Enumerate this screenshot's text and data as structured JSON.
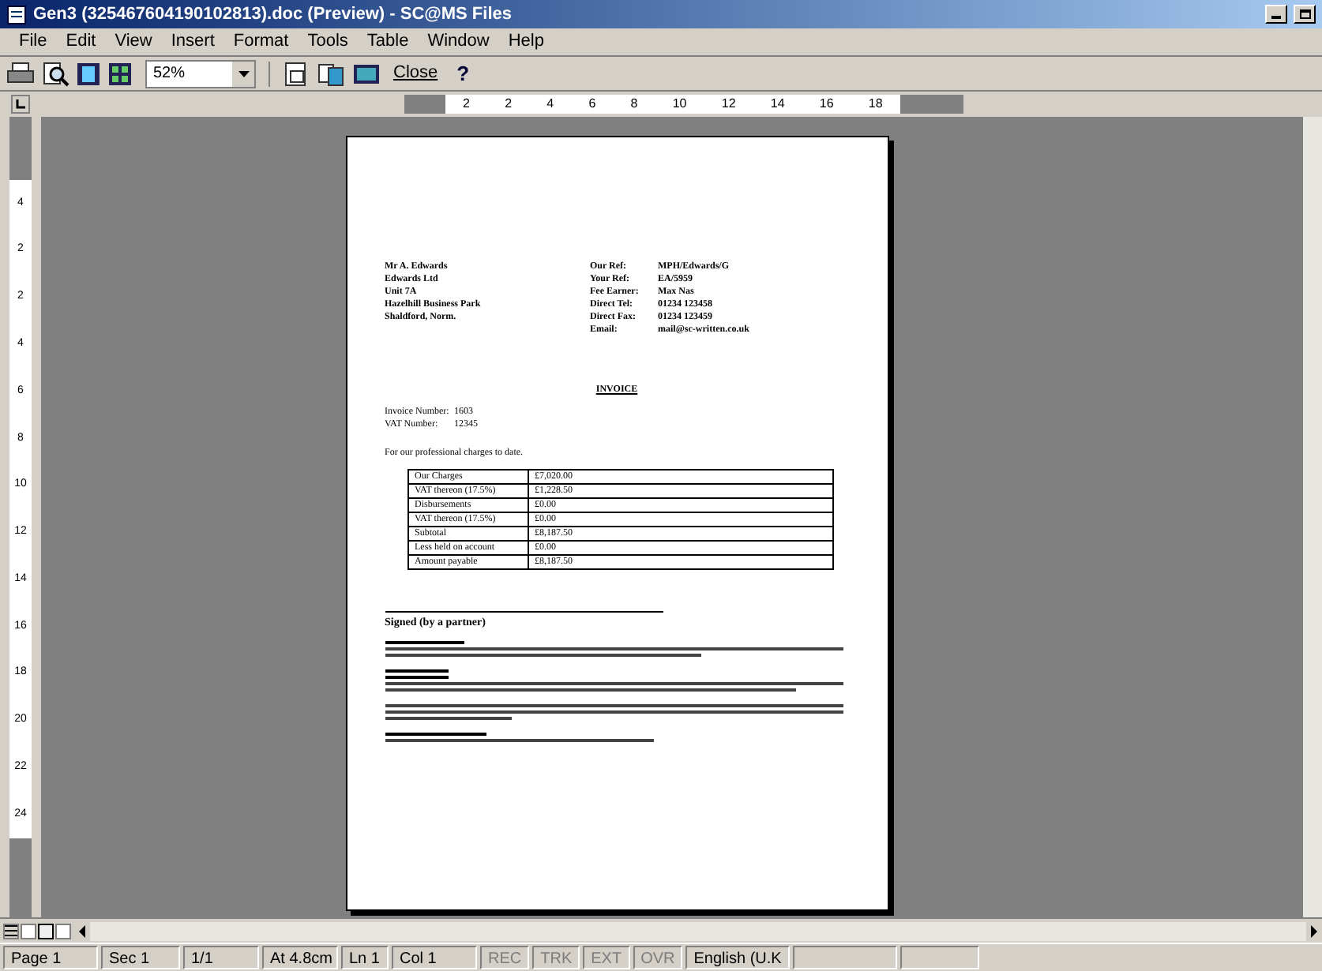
{
  "window": {
    "title": "Gen3 (325467604190102813).doc (Preview) - SC@MS Files"
  },
  "menu": [
    "File",
    "Edit",
    "View",
    "Insert",
    "Format",
    "Tools",
    "Table",
    "Window",
    "Help"
  ],
  "toolbar": {
    "zoom": "52%",
    "close": "Close",
    "help": "?"
  },
  "ruler": {
    "horizontal": [
      "2",
      "2",
      "4",
      "6",
      "8",
      "10",
      "12",
      "14",
      "16",
      "18"
    ],
    "vertical": [
      "4",
      "2",
      "2",
      "4",
      "6",
      "8",
      "10",
      "12",
      "14",
      "16",
      "18",
      "20",
      "22",
      "24"
    ]
  },
  "document": {
    "address": [
      "Mr A. Edwards",
      "Edwards Ltd",
      "Unit 7A",
      "Hazelhill Business Park",
      "Shaldford, Norm."
    ],
    "refs": [
      {
        "label": "Our Ref:",
        "value": "MPH/Edwards/G"
      },
      {
        "label": "Your Ref:",
        "value": "EA/5959"
      },
      {
        "label": "Fee Earner:",
        "value": "Max Nas"
      },
      {
        "label": "Direct Tel:",
        "value": "01234 123458"
      },
      {
        "label": "Direct Fax:",
        "value": "01234 123459"
      },
      {
        "label": "Email:",
        "value": "mail@sc-written.co.uk"
      }
    ],
    "heading": "INVOICE",
    "numbers": [
      {
        "label": "Invoice Number:",
        "value": "1603"
      },
      {
        "label": "VAT Number:",
        "value": "12345"
      }
    ],
    "intro": "For our professional charges to date.",
    "charges": [
      {
        "item": "Our Charges",
        "amount": "£7,020.00"
      },
      {
        "item": "VAT thereon (17.5%)",
        "amount": "£1,228.50"
      },
      {
        "item": "Disbursements",
        "amount": "£0.00"
      },
      {
        "item": "VAT thereon (17.5%)",
        "amount": "£0.00"
      },
      {
        "item": "Subtotal",
        "amount": "£8,187.50"
      },
      {
        "item": "Less held on account",
        "amount": "£0.00"
      },
      {
        "item": "Amount payable",
        "amount": "£8,187.50"
      }
    ],
    "signature": "Signed (by a partner)"
  },
  "status_bar": [
    {
      "text": "Page 1",
      "disabled": false
    },
    {
      "text": "Sec 1",
      "disabled": false
    },
    {
      "text": "1/1",
      "disabled": false
    },
    {
      "text": "At 4.8cm",
      "disabled": false
    },
    {
      "text": "Ln 1",
      "disabled": false
    },
    {
      "text": "Col 1",
      "disabled": false
    },
    {
      "text": "REC",
      "disabled": true
    },
    {
      "text": "TRK",
      "disabled": true
    },
    {
      "text": "EXT",
      "disabled": true
    },
    {
      "text": "OVR",
      "disabled": true
    },
    {
      "text": "English (U.K",
      "disabled": false
    }
  ]
}
